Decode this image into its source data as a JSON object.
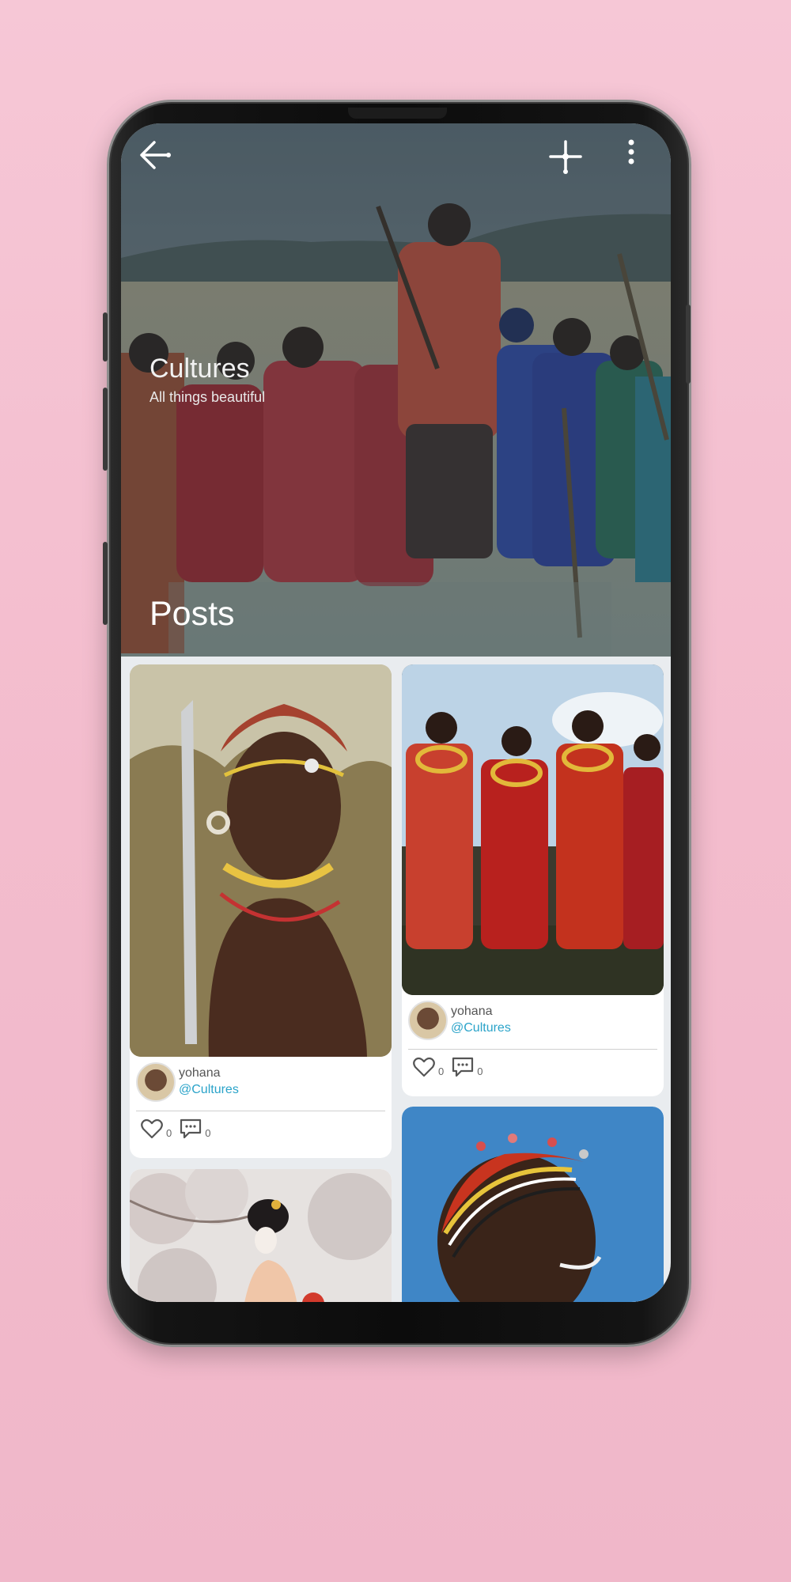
{
  "header": {
    "title": "Cultures",
    "subtitle": "All things beautiful",
    "section_title": "Posts"
  },
  "icons": {
    "back": "arrow-left-icon",
    "add": "plus-icon",
    "menu": "more-vert-icon",
    "like": "heart-icon",
    "comment": "comment-icon"
  },
  "colors": {
    "background": "#f3bccd",
    "handle": "#2aa3c9"
  },
  "posts": [
    {
      "author": "yohana",
      "handle": "@Cultures",
      "likes": "0",
      "comments": "0"
    },
    {
      "author": "yohana",
      "handle": "@Cultures",
      "likes": "0",
      "comments": "0"
    }
  ]
}
